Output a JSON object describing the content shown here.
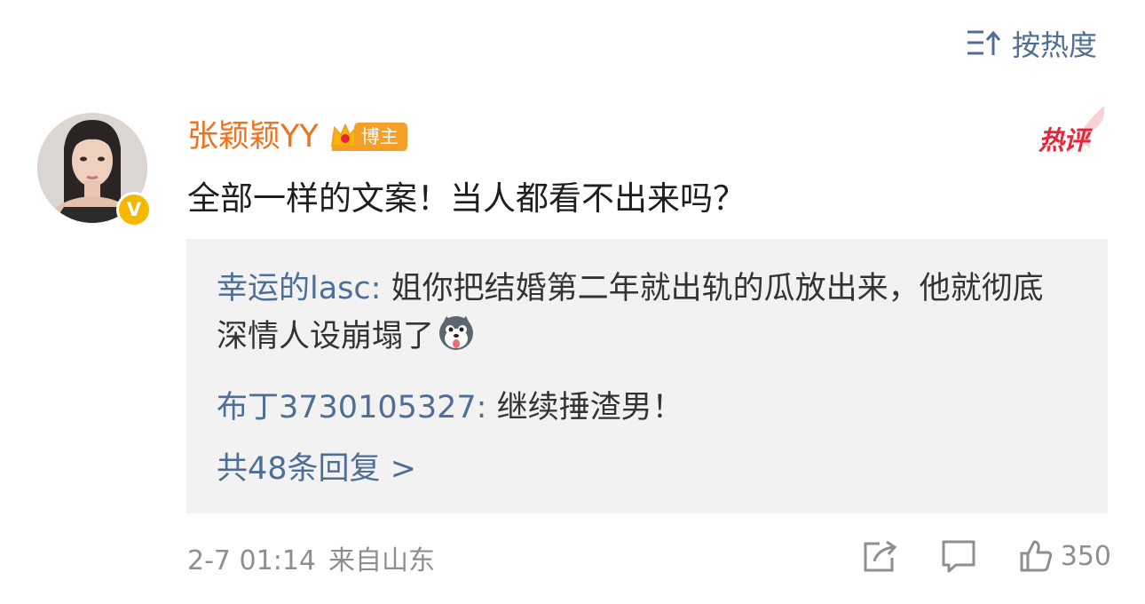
{
  "sort": {
    "label": "按热度",
    "icon": "sort-hot-icon"
  },
  "comment": {
    "username": "张颖颖YY",
    "badge_label": "博主",
    "hot_label": "热评",
    "text": "全部一样的文案！当人都看不出来吗？",
    "verified_mark": "V",
    "timestamp": "2-7 01:14",
    "location": "来自山东",
    "like_count": "350"
  },
  "replies": [
    {
      "author": "幸运的lasc:",
      "text": " 姐你把结婚第二年就出轨的瓜放出来，他就彻底深情人设崩塌了",
      "emoji": "husky-emoji"
    },
    {
      "author": "布丁3730105327:",
      "text": " 继续捶渣男！"
    }
  ],
  "more_replies": "共48条回复 >",
  "colors": {
    "link_blue": "#4f6e95",
    "username_orange": "#f0721c",
    "hot_red": "#e8253a",
    "verified_gold": "#f5b800",
    "reply_bg": "#f2f2f2",
    "meta_gray": "#8e8e8e"
  }
}
